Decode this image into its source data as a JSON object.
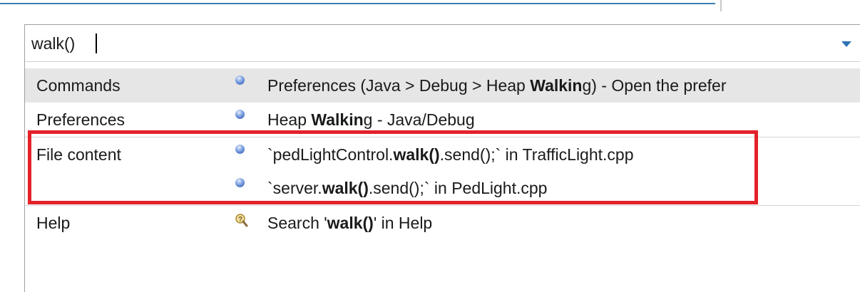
{
  "search": {
    "value": "walk()"
  },
  "results": [
    {
      "category": "Commands",
      "icon": "preference-ball-icon",
      "pre": "Preferences (Java > Debug > Heap ",
      "bold": "Walkin",
      "post": "g) - Open the prefer"
    },
    {
      "category": "Preferences",
      "icon": "preference-ball-icon",
      "pre": "Heap ",
      "bold": "Walkin",
      "post": "g - Java/Debug"
    },
    {
      "category": "File content",
      "icon": "file-ball-icon",
      "pre": "`pedLightControl.",
      "bold": "walk()",
      "post": ".send();` in TrafficLight.cpp"
    },
    {
      "category": "",
      "icon": "file-ball-icon",
      "pre": "`server.",
      "bold": "walk()",
      "post": ".send();` in PedLight.cpp"
    },
    {
      "category": "Help",
      "icon": "help-search-icon",
      "pre": "Search '",
      "bold": "walk()",
      "post": "' in Help"
    }
  ],
  "colors": {
    "highlight_border": "#e3222a",
    "selected_row": "#e6e6e6",
    "accent": "#2f73b5"
  }
}
